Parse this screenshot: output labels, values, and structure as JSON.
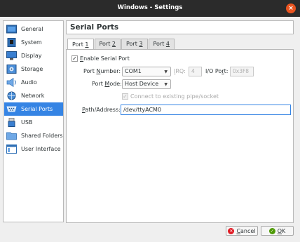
{
  "window": {
    "title": "Windows - Settings",
    "close_icon": "×"
  },
  "sidebar": {
    "items": [
      {
        "label": "General",
        "icon": "general-icon",
        "selected": false
      },
      {
        "label": "System",
        "icon": "system-icon",
        "selected": false
      },
      {
        "label": "Display",
        "icon": "display-icon",
        "selected": false
      },
      {
        "label": "Storage",
        "icon": "storage-icon",
        "selected": false
      },
      {
        "label": "Audio",
        "icon": "audio-icon",
        "selected": false
      },
      {
        "label": "Network",
        "icon": "network-icon",
        "selected": false
      },
      {
        "label": "Serial Ports",
        "icon": "serial-ports-icon",
        "selected": true
      },
      {
        "label": "USB",
        "icon": "usb-icon",
        "selected": false
      },
      {
        "label": "Shared Folders",
        "icon": "shared-folders-icon",
        "selected": false
      },
      {
        "label": "User Interface",
        "icon": "user-interface-icon",
        "selected": false
      }
    ]
  },
  "section": {
    "title": "Serial Ports"
  },
  "tabs": [
    {
      "prefix": "Port ",
      "mnemonic": "1"
    },
    {
      "prefix": "Port ",
      "mnemonic": "2"
    },
    {
      "prefix": "Port ",
      "mnemonic": "3"
    },
    {
      "prefix": "Port ",
      "mnemonic": "4"
    }
  ],
  "port": {
    "enable_mnemonic": "E",
    "enable_rest": "nable Serial Port",
    "enable_checked": "✓",
    "port_number_pre": "Port ",
    "port_number_mn": "N",
    "port_number_post": "umber:",
    "port_number_value": "COM1",
    "irq_pre": "",
    "irq_mn": "I",
    "irq_post": "RQ:",
    "irq_value": "4",
    "io_pre": "I/O Po",
    "io_mn": "r",
    "io_post": "t:",
    "io_value": "0x3F8",
    "mode_pre": "Port ",
    "mode_mn": "M",
    "mode_post": "ode:",
    "mode_value": "Host Device",
    "connect_label": "Connect to existing pipe/socket",
    "connect_checked": "✓",
    "path_pre": "",
    "path_mn": "P",
    "path_post": "ath/Address:",
    "path_value": "/dev/ttyACM0",
    "combo_arrow": "▼"
  },
  "buttons": {
    "cancel_pre": "",
    "cancel_mn": "C",
    "cancel_post": "ancel",
    "cancel_icon": "✕",
    "ok_pre": "",
    "ok_mn": "O",
    "ok_post": "K",
    "ok_icon": "✓"
  },
  "colors": {
    "accent": "#3584e4",
    "titlebar": "#2b2b2b",
    "close": "#e95420",
    "cancel_icon": "#e01b24",
    "ok_icon": "#4e9a06"
  }
}
